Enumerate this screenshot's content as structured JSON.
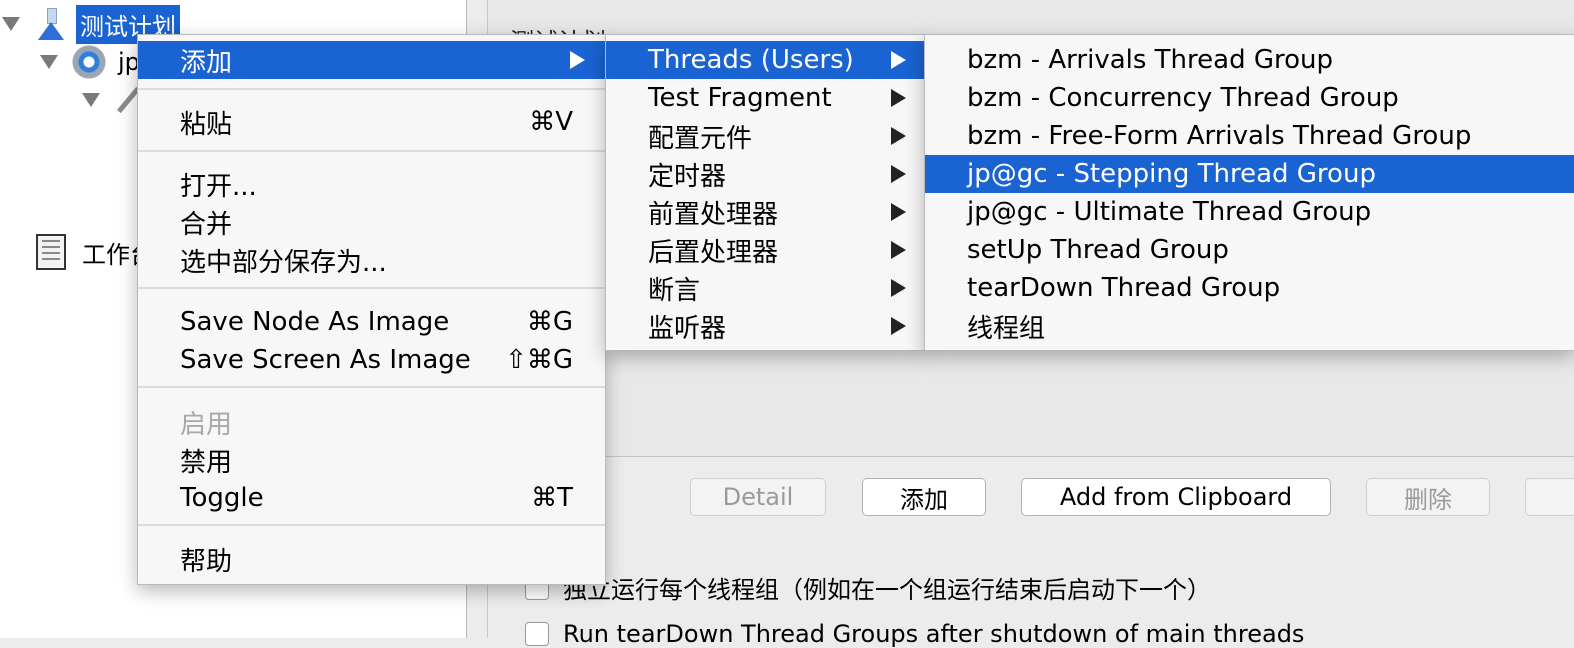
{
  "tree": {
    "root_label": "测试计划",
    "child1_label": "jp",
    "child3_label": "工作台"
  },
  "right_panel": {
    "partial_title": "测试计划",
    "buttons": {
      "detail": "Detail",
      "add": "添加",
      "add_from_clipboard": "Add from Clipboard",
      "delete": "删除"
    },
    "checkbox1_label": "独立运行每个线程组（例如在一个组运行结束后启动下一个）",
    "checkbox2_label": "Run tearDown Thread Groups after shutdown of main threads"
  },
  "context_menu": {
    "add": "添加",
    "paste": "粘贴",
    "paste_shortcut": "⌘V",
    "open": "打开...",
    "merge": "合并",
    "save_selection_as": "选中部分保存为...",
    "save_node_as_image": "Save Node As Image",
    "save_node_shortcut": "⌘G",
    "save_screen_as_image": "Save Screen As Image",
    "save_screen_shortcut": "⇧⌘G",
    "enable": "启用",
    "disable": "禁用",
    "toggle": "Toggle",
    "toggle_shortcut": "⌘T",
    "help": "帮助"
  },
  "submenu_add": {
    "threads": "Threads (Users)",
    "test_fragment": "Test Fragment",
    "config_element": "配置元件",
    "timer": "定时器",
    "pre_processor": "前置处理器",
    "post_processor": "后置处理器",
    "assertion": "断言",
    "listener": "监听器"
  },
  "submenu_threads": {
    "items": [
      "bzm - Arrivals Thread Group",
      "bzm - Concurrency Thread Group",
      "bzm - Free-Form Arrivals Thread Group",
      "jp@gc - Stepping Thread Group",
      "jp@gc - Ultimate Thread Group",
      "setUp Thread Group",
      "tearDown Thread Group",
      "线程组"
    ]
  },
  "colors": {
    "highlight": "#1a63d2",
    "menu_background": "#f7f7f7"
  }
}
